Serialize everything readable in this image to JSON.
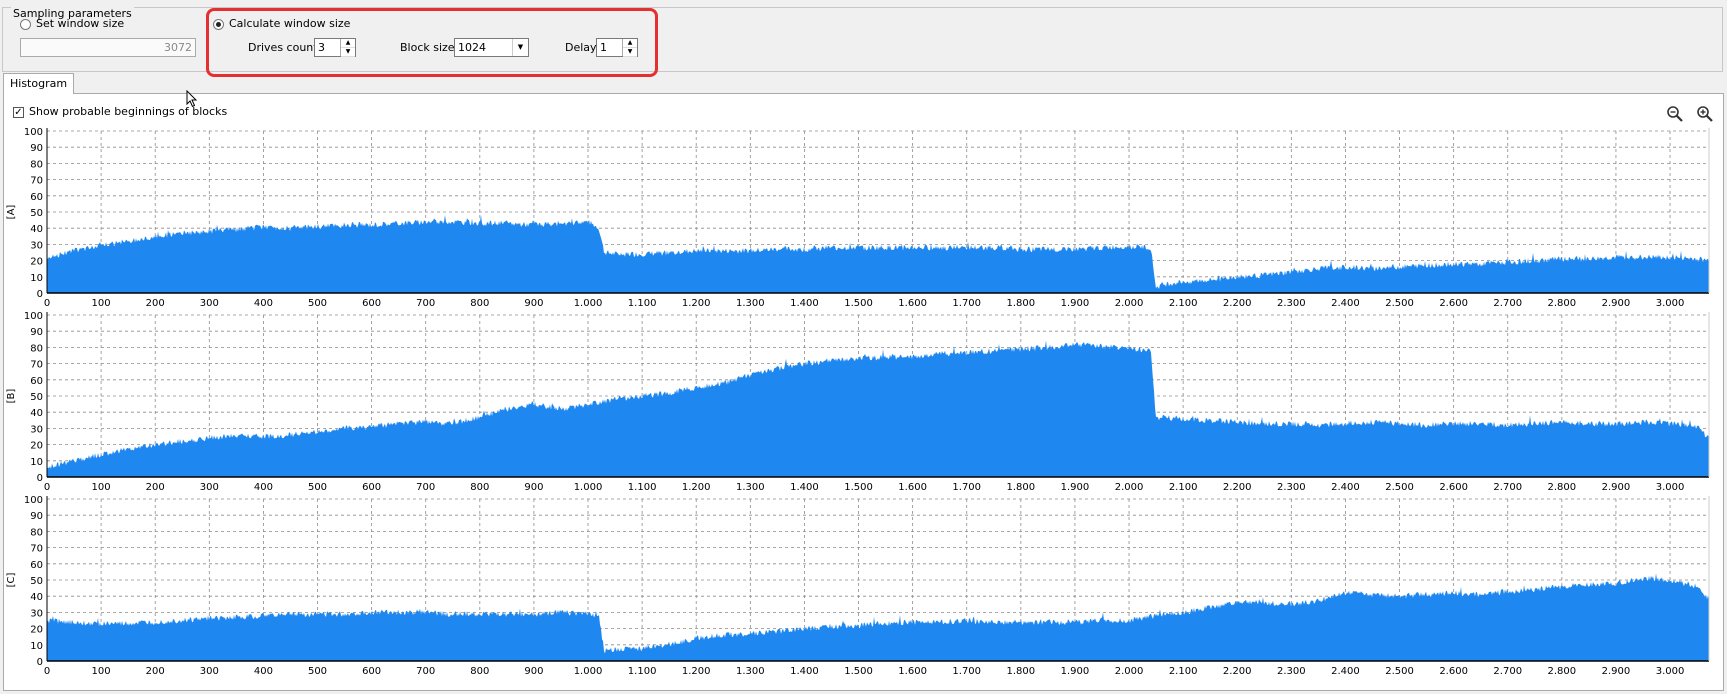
{
  "sampling": {
    "group_title": "Sampling parameters",
    "set_window_label": "Set window size",
    "window_size_value": "3072",
    "calculate_label": "Calculate window size",
    "drives_count_label": "Drives count",
    "drives_count_value": "3",
    "block_size_label": "Block size",
    "block_size_value": "1024",
    "delay_label": "Delay",
    "delay_value": "1",
    "selected_mode": "calculate"
  },
  "tabs": {
    "histogram_label": "Histogram"
  },
  "options": {
    "show_beginnings_label": "Show probable beginnings of blocks",
    "show_beginnings_checked": true
  },
  "toolbar": {
    "zoom_out_icon": "zoom-out-icon",
    "zoom_in_icon": "zoom-in-icon"
  },
  "colors": {
    "bar_fill": "#1e87f0",
    "highlight": "#e33030",
    "grid": "#8c8c8c"
  },
  "chart_data": [
    {
      "type": "area",
      "ylabel": "[A]",
      "ylim": [
        0,
        100
      ],
      "yticks": [
        0,
        10,
        20,
        30,
        40,
        50,
        60,
        70,
        80,
        90,
        100
      ],
      "xlim": [
        0,
        3072
      ],
      "xticks": [
        "0",
        "100",
        "200",
        "300",
        "400",
        "500",
        "600",
        "700",
        "800",
        "900",
        "1.000",
        "1.100",
        "1.200",
        "1.300",
        "1.400",
        "1.500",
        "1.600",
        "1.700",
        "1.800",
        "1.900",
        "2.000",
        "2.100",
        "2.200",
        "2.300",
        "2.400",
        "2.500",
        "2.600",
        "2.700",
        "2.800",
        "2.900",
        "3.000"
      ],
      "grid": true,
      "x": [
        0,
        50,
        100,
        150,
        200,
        250,
        300,
        350,
        400,
        450,
        500,
        550,
        600,
        650,
        700,
        750,
        800,
        850,
        900,
        950,
        1000,
        1020,
        1030,
        1050,
        1100,
        1150,
        1200,
        1250,
        1300,
        1350,
        1400,
        1450,
        1500,
        1550,
        1600,
        1650,
        1700,
        1750,
        1800,
        1850,
        1900,
        1950,
        2000,
        2040,
        2050,
        2060,
        2100,
        2150,
        2200,
        2250,
        2300,
        2350,
        2400,
        2450,
        2500,
        2550,
        2600,
        2650,
        2700,
        2750,
        2800,
        2850,
        2900,
        2950,
        3000,
        3050,
        3072
      ],
      "values": [
        22,
        26,
        29,
        32,
        35,
        37,
        38,
        39,
        41,
        40,
        41,
        42,
        42,
        43,
        44,
        44,
        43,
        43,
        42,
        43,
        44,
        40,
        25,
        24,
        24,
        25,
        26,
        26,
        26,
        27,
        27,
        28,
        28,
        28,
        28,
        28,
        28,
        28,
        27,
        27,
        27,
        28,
        29,
        28,
        3,
        5,
        7,
        8,
        10,
        11,
        13,
        15,
        16,
        15,
        16,
        17,
        18,
        18,
        19,
        20,
        21,
        21,
        22,
        22,
        22,
        21,
        20
      ]
    },
    {
      "type": "area",
      "ylabel": "[B]",
      "ylim": [
        0,
        100
      ],
      "yticks": [
        0,
        10,
        20,
        30,
        40,
        50,
        60,
        70,
        80,
        90,
        100
      ],
      "xlim": [
        0,
        3072
      ],
      "xticks": [
        "0",
        "100",
        "200",
        "300",
        "400",
        "500",
        "600",
        "700",
        "800",
        "900",
        "1.000",
        "1.100",
        "1.200",
        "1.300",
        "1.400",
        "1.500",
        "1.600",
        "1.700",
        "1.800",
        "1.900",
        "2.000",
        "2.100",
        "2.200",
        "2.300",
        "2.400",
        "2.500",
        "2.600",
        "2.700",
        "2.800",
        "2.900",
        "3.000"
      ],
      "grid": true,
      "x": [
        0,
        50,
        100,
        150,
        200,
        250,
        300,
        350,
        400,
        450,
        500,
        550,
        600,
        650,
        700,
        750,
        800,
        850,
        900,
        950,
        1000,
        1050,
        1100,
        1150,
        1200,
        1250,
        1300,
        1350,
        1400,
        1450,
        1500,
        1550,
        1600,
        1650,
        1700,
        1750,
        1800,
        1850,
        1900,
        1950,
        2000,
        2040,
        2050,
        2060,
        2100,
        2150,
        2200,
        2250,
        2300,
        2350,
        2400,
        2450,
        2500,
        2550,
        2600,
        2650,
        2700,
        2750,
        2800,
        2850,
        2900,
        2950,
        3000,
        3050,
        3072
      ],
      "values": [
        6,
        10,
        14,
        17,
        20,
        22,
        24,
        26,
        25,
        26,
        28,
        30,
        31,
        33,
        34,
        33,
        37,
        42,
        45,
        42,
        45,
        48,
        50,
        52,
        55,
        58,
        63,
        67,
        70,
        72,
        73,
        74,
        74,
        76,
        77,
        78,
        79,
        80,
        82,
        81,
        79,
        78,
        36,
        37,
        36,
        35,
        34,
        33,
        33,
        32,
        33,
        34,
        33,
        32,
        33,
        33,
        32,
        33,
        34,
        33,
        33,
        34,
        33,
        31,
        24
      ]
    },
    {
      "type": "area",
      "ylabel": "[C]",
      "ylim": [
        0,
        100
      ],
      "yticks": [
        0,
        10,
        20,
        30,
        40,
        50,
        60,
        70,
        80,
        90,
        100
      ],
      "xlim": [
        0,
        3072
      ],
      "xticks": [
        "0",
        "100",
        "200",
        "300",
        "400",
        "500",
        "600",
        "700",
        "800",
        "900",
        "1.000",
        "1.100",
        "1.200",
        "1.300",
        "1.400",
        "1.500",
        "1.600",
        "1.700",
        "1.800",
        "1.900",
        "2.000",
        "2.100",
        "2.200",
        "2.300",
        "2.400",
        "2.500",
        "2.600",
        "2.700",
        "2.800",
        "2.900",
        "3.000"
      ],
      "grid": true,
      "x": [
        0,
        50,
        100,
        150,
        200,
        250,
        300,
        350,
        400,
        450,
        500,
        550,
        600,
        650,
        700,
        750,
        800,
        850,
        900,
        950,
        1000,
        1020,
        1030,
        1050,
        1100,
        1150,
        1200,
        1250,
        1300,
        1350,
        1400,
        1450,
        1500,
        1550,
        1600,
        1650,
        1700,
        1750,
        1800,
        1850,
        1900,
        1950,
        2000,
        2050,
        2100,
        2150,
        2200,
        2250,
        2300,
        2350,
        2400,
        2450,
        2500,
        2550,
        2600,
        2650,
        2700,
        2750,
        2800,
        2850,
        2900,
        2950,
        3000,
        3050,
        3072
      ],
      "values": [
        25,
        24,
        23,
        23,
        24,
        25,
        26,
        27,
        28,
        29,
        29,
        29,
        30,
        30,
        30,
        29,
        29,
        29,
        29,
        30,
        29,
        28,
        6,
        7,
        8,
        10,
        14,
        16,
        17,
        18,
        20,
        21,
        22,
        23,
        24,
        24,
        25,
        24,
        24,
        24,
        24,
        25,
        25,
        28,
        30,
        33,
        36,
        36,
        35,
        37,
        42,
        41,
        40,
        41,
        42,
        41,
        43,
        44,
        46,
        47,
        48,
        51,
        50,
        46,
        38
      ]
    }
  ]
}
